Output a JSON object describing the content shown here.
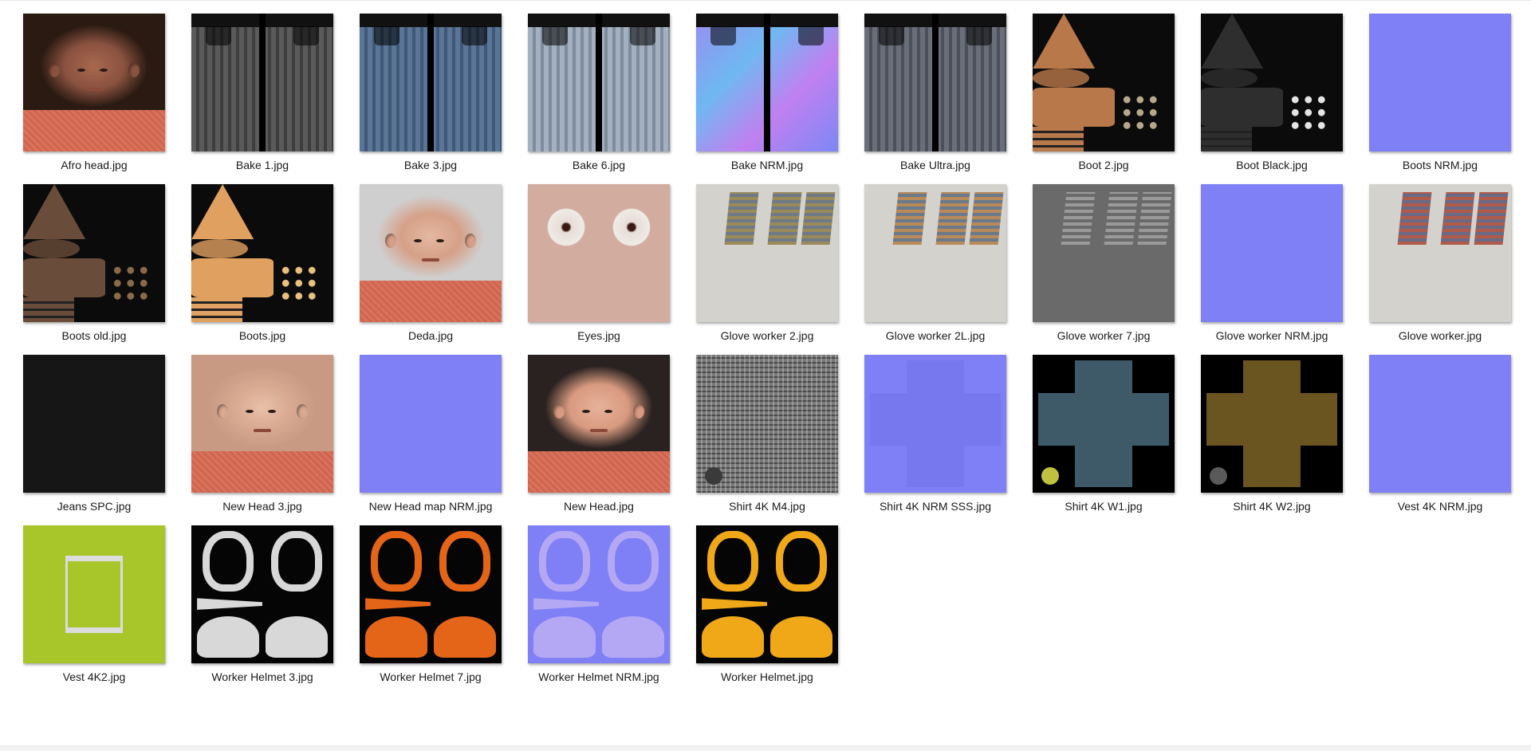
{
  "files": [
    {
      "name": "Afro head.jpg",
      "thumb": "face",
      "skin": "#8a5240",
      "skin2": "#a8684e",
      "hair": "#2a1a12"
    },
    {
      "name": "Bake 1.jpg",
      "thumb": "jeans",
      "c1": "#5a5a5a",
      "c2": "#3e3e3e"
    },
    {
      "name": "Bake 3.jpg",
      "thumb": "jeans",
      "c1": "#5b7596",
      "c2": "#3f5878"
    },
    {
      "name": "Bake 6.jpg",
      "thumb": "jeans",
      "c1": "#a4b0bf",
      "c2": "#7d8b9c"
    },
    {
      "name": "Bake NRM.jpg",
      "thumb": "jeans-nrm"
    },
    {
      "name": "Bake Ultra.jpg",
      "thumb": "jeans",
      "c1": "#6a6e78",
      "c2": "#4c505a"
    },
    {
      "name": "Boot 2.jpg",
      "thumb": "boot",
      "main": "#b8784a",
      "stud": "#b5a88c"
    },
    {
      "name": "Boot Black.jpg",
      "thumb": "boot",
      "main": "#2e2e2e",
      "stud": "#e5e5e5"
    },
    {
      "name": "Boots NRM.jpg",
      "thumb": "nrm"
    },
    {
      "name": "Boots old.jpg",
      "thumb": "boot",
      "main": "#6a4c3a",
      "stud": "#8a6a4a"
    },
    {
      "name": "Boots.jpg",
      "thumb": "boot",
      "main": "#e0a060",
      "stud": "#e8c080"
    },
    {
      "name": "Deda.jpg",
      "thumb": "face",
      "skin": "#d6a088",
      "skin2": "#e4b8a0",
      "hair": "#cfcfcf"
    },
    {
      "name": "Eyes.jpg",
      "thumb": "eyes"
    },
    {
      "name": "Glove worker 2.jpg",
      "thumb": "glove",
      "g1": "#9a8a5a",
      "g2": "#6f7a86"
    },
    {
      "name": "Glove worker 2L.jpg",
      "thumb": "glove",
      "g1": "#b88a5a",
      "g2": "#6a7a8a"
    },
    {
      "name": "Glove worker 7.jpg",
      "thumb": "glove-gray",
      "g1": "#9a9a9a",
      "g2": "#6a6a6a"
    },
    {
      "name": "Glove worker NRM.jpg",
      "thumb": "nrm"
    },
    {
      "name": "Glove worker.jpg",
      "thumb": "glove",
      "g1": "#b05a4a",
      "g2": "#6a6a86"
    },
    {
      "name": "Jeans SPC.jpg",
      "thumb": "dark"
    },
    {
      "name": "New Head 3.jpg",
      "thumb": "face",
      "skin": "#d8a890",
      "skin2": "#e8c0a8",
      "hair": "#c89a84"
    },
    {
      "name": "New Head map NRM.jpg",
      "thumb": "nrm"
    },
    {
      "name": "New Head.jpg",
      "thumb": "face",
      "skin": "#d89a80",
      "skin2": "#e6b29a",
      "hair": "#2a2220"
    },
    {
      "name": "Shirt 4K M4.jpg",
      "thumb": "plaid",
      "btn": "#3a3a3a"
    },
    {
      "name": "Shirt 4K NRM SSS.jpg",
      "thumb": "cross-nrm"
    },
    {
      "name": "Shirt 4K W1.jpg",
      "thumb": "cross",
      "cross": "#3e5a68",
      "btn": "#c0c040"
    },
    {
      "name": "Shirt 4K W2.jpg",
      "thumb": "cross",
      "cross": "#6a5420",
      "btn": "#5a5a5a"
    },
    {
      "name": "Vest 4K NRM.jpg",
      "thumb": "nrm"
    },
    {
      "name": "Vest 4K2.jpg",
      "thumb": "vest"
    },
    {
      "name": "Worker Helmet 3.jpg",
      "thumb": "helmet",
      "h": "#d8d8d8"
    },
    {
      "name": "Worker Helmet 7.jpg",
      "thumb": "helmet",
      "h": "#e46418"
    },
    {
      "name": "Worker Helmet NRM.jpg",
      "thumb": "helmet-nrm",
      "h": "#b4a8f4"
    },
    {
      "name": "Worker Helmet.jpg",
      "thumb": "helmet",
      "h": "#f0a818"
    }
  ]
}
